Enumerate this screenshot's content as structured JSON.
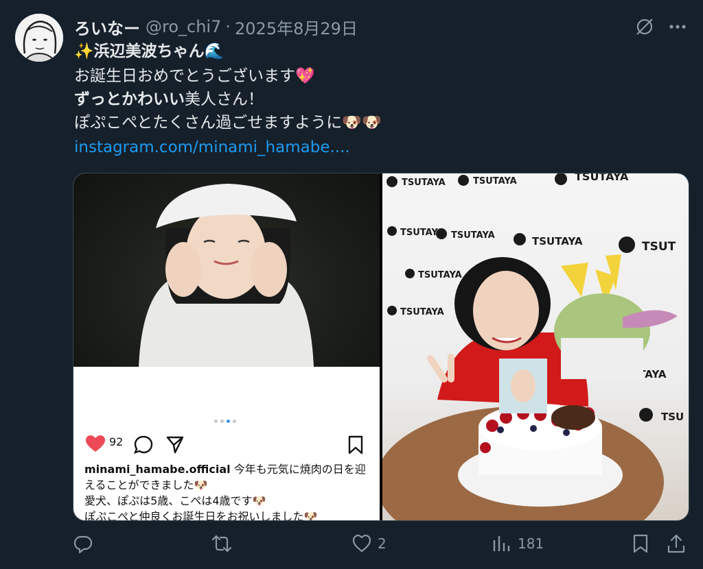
{
  "post": {
    "display_name": "ろいなー",
    "handle": "@ro_chi7",
    "separator": "·",
    "date": "2025年8月29日",
    "text_line1": "✨浜辺美波ちゃん🌊",
    "text_line2": "お誕生日おめでとうございます💖",
    "text_line3_bold": "ずっとかわいい",
    "text_line3_rest": "美人さん！",
    "text_line4": "ぽぷこぺとたくさん過ごせますように🐶🐶",
    "link": "instagram.com/minami_hamabe...."
  },
  "media": {
    "left_instagram": {
      "like_count": "92",
      "caption_user": "minami_hamabe.official",
      "caption_text_1": "今年も元気に焼肉の日を迎えることができました🐶",
      "caption_text_2": "愛犬、ぽぷは5歳、こぺは4歳です🐶",
      "caption_text_3": "ぽぷこぺと仲良くお誕生日をお祝いしました🐶"
    },
    "right_photo": {
      "backdrop_brand": "TSUTAYA"
    }
  },
  "actions": {
    "reply_count": "",
    "retweet_count": "",
    "like_count": "2",
    "views_count": "181"
  },
  "colors": {
    "background": "#15202b",
    "text": "#e7e9ea",
    "muted": "#8b98a5",
    "link": "#1d9bf0",
    "heart": "#ed4956"
  }
}
